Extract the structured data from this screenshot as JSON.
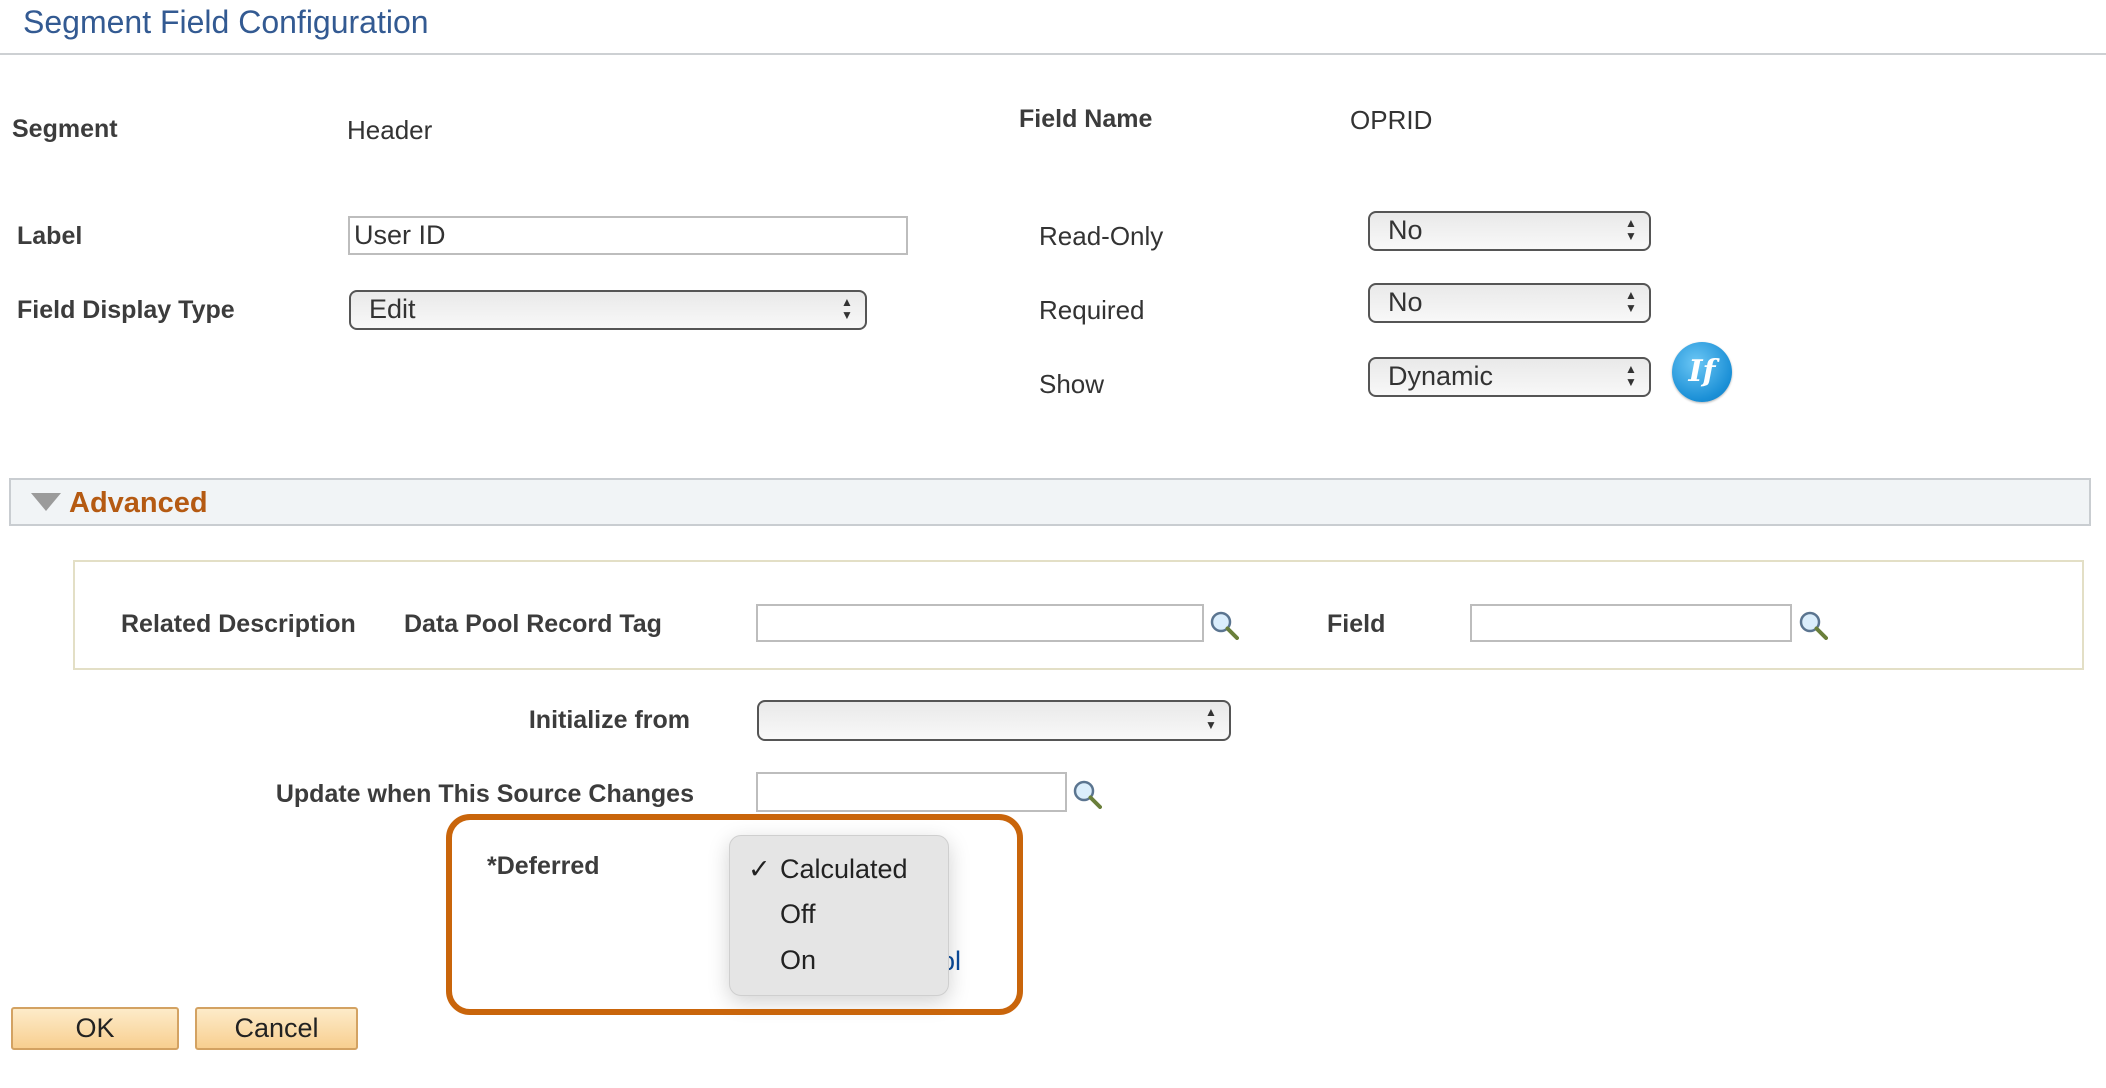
{
  "page": {
    "title": "Segment Field Configuration"
  },
  "fields": {
    "segment": {
      "label": "Segment",
      "value": "Header"
    },
    "field_name": {
      "label": "Field Name",
      "value": "OPRID"
    },
    "label": {
      "label": "Label",
      "value": "User ID"
    },
    "field_display_type": {
      "label": "Field Display Type",
      "value": "Edit"
    },
    "read_only": {
      "label": "Read-Only",
      "value": "No"
    },
    "required": {
      "label": "Required",
      "value": "No"
    },
    "show": {
      "label": "Show",
      "value": "Dynamic",
      "icon": "if-condition-icon",
      "icon_text": "If"
    }
  },
  "advanced": {
    "title": "Advanced",
    "related_description": "Related Description",
    "data_pool_record_tag": {
      "label": "Data Pool Record Tag",
      "value": ""
    },
    "field": {
      "label": "Field",
      "value": ""
    },
    "initialize_from": {
      "label": "Initialize from",
      "value": ""
    },
    "update_source": {
      "label": "Update when This Source Changes",
      "value": ""
    },
    "deferred": {
      "label": "*Deferred",
      "options": [
        {
          "label": "Calculated",
          "selected": true
        },
        {
          "label": "Off",
          "selected": false
        },
        {
          "label": "On",
          "selected": false
        }
      ],
      "check_glyph": "✓"
    },
    "partial_link": "ol"
  },
  "buttons": {
    "ok": "OK",
    "cancel": "Cancel"
  },
  "colors": {
    "title": "#335a92",
    "advanced": "#b55a12",
    "highlight": "#c9650b",
    "link": "#0b4b9a"
  }
}
